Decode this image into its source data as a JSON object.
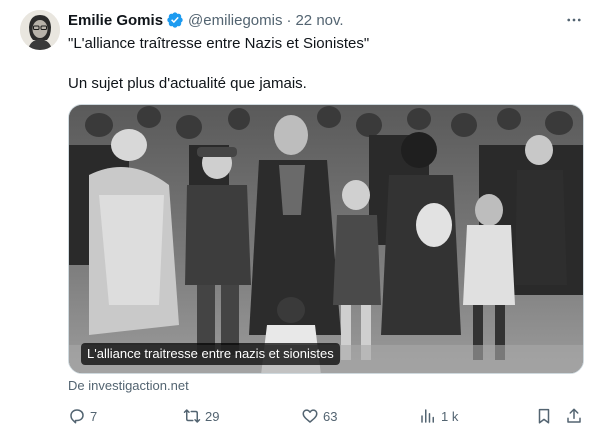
{
  "author": {
    "name": "Emilie Gomis",
    "handle": "@emiliegomis",
    "separator": "·",
    "date": "22 nov."
  },
  "tweet": {
    "line1": "\"L'alliance traîtresse entre Nazis et Sionistes\"",
    "line2": "Un sujet plus d'actualité que jamais."
  },
  "media": {
    "caption": "L'alliance traitresse entre nazis et sionistes",
    "source": "De investigaction.net"
  },
  "actions": {
    "replies": "7",
    "retweets": "29",
    "likes": "63",
    "views": "1 k"
  },
  "colors": {
    "verified": "#1d9bf0",
    "secondary_text": "#536471"
  },
  "icons": {
    "verified": "verified-badge-icon",
    "more": "more-icon",
    "reply": "reply-icon",
    "retweet": "retweet-icon",
    "like": "like-icon",
    "views": "views-icon",
    "bookmark": "bookmark-icon",
    "share": "share-icon"
  }
}
